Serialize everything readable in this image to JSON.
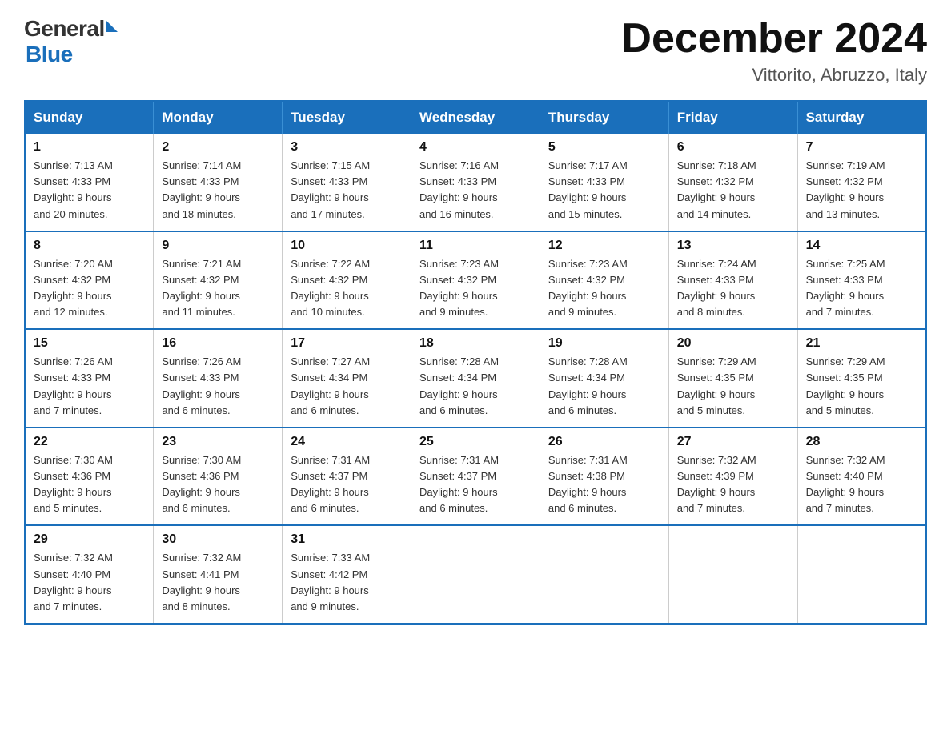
{
  "header": {
    "logo_general": "General",
    "logo_blue": "Blue",
    "title": "December 2024",
    "location": "Vittorito, Abruzzo, Italy"
  },
  "days_of_week": [
    "Sunday",
    "Monday",
    "Tuesday",
    "Wednesday",
    "Thursday",
    "Friday",
    "Saturday"
  ],
  "weeks": [
    [
      {
        "day": "1",
        "sunrise": "7:13 AM",
        "sunset": "4:33 PM",
        "daylight": "9 hours and 20 minutes."
      },
      {
        "day": "2",
        "sunrise": "7:14 AM",
        "sunset": "4:33 PM",
        "daylight": "9 hours and 18 minutes."
      },
      {
        "day": "3",
        "sunrise": "7:15 AM",
        "sunset": "4:33 PM",
        "daylight": "9 hours and 17 minutes."
      },
      {
        "day": "4",
        "sunrise": "7:16 AM",
        "sunset": "4:33 PM",
        "daylight": "9 hours and 16 minutes."
      },
      {
        "day": "5",
        "sunrise": "7:17 AM",
        "sunset": "4:33 PM",
        "daylight": "9 hours and 15 minutes."
      },
      {
        "day": "6",
        "sunrise": "7:18 AM",
        "sunset": "4:32 PM",
        "daylight": "9 hours and 14 minutes."
      },
      {
        "day": "7",
        "sunrise": "7:19 AM",
        "sunset": "4:32 PM",
        "daylight": "9 hours and 13 minutes."
      }
    ],
    [
      {
        "day": "8",
        "sunrise": "7:20 AM",
        "sunset": "4:32 PM",
        "daylight": "9 hours and 12 minutes."
      },
      {
        "day": "9",
        "sunrise": "7:21 AM",
        "sunset": "4:32 PM",
        "daylight": "9 hours and 11 minutes."
      },
      {
        "day": "10",
        "sunrise": "7:22 AM",
        "sunset": "4:32 PM",
        "daylight": "9 hours and 10 minutes."
      },
      {
        "day": "11",
        "sunrise": "7:23 AM",
        "sunset": "4:32 PM",
        "daylight": "9 hours and 9 minutes."
      },
      {
        "day": "12",
        "sunrise": "7:23 AM",
        "sunset": "4:32 PM",
        "daylight": "9 hours and 9 minutes."
      },
      {
        "day": "13",
        "sunrise": "7:24 AM",
        "sunset": "4:33 PM",
        "daylight": "9 hours and 8 minutes."
      },
      {
        "day": "14",
        "sunrise": "7:25 AM",
        "sunset": "4:33 PM",
        "daylight": "9 hours and 7 minutes."
      }
    ],
    [
      {
        "day": "15",
        "sunrise": "7:26 AM",
        "sunset": "4:33 PM",
        "daylight": "9 hours and 7 minutes."
      },
      {
        "day": "16",
        "sunrise": "7:26 AM",
        "sunset": "4:33 PM",
        "daylight": "9 hours and 6 minutes."
      },
      {
        "day": "17",
        "sunrise": "7:27 AM",
        "sunset": "4:34 PM",
        "daylight": "9 hours and 6 minutes."
      },
      {
        "day": "18",
        "sunrise": "7:28 AM",
        "sunset": "4:34 PM",
        "daylight": "9 hours and 6 minutes."
      },
      {
        "day": "19",
        "sunrise": "7:28 AM",
        "sunset": "4:34 PM",
        "daylight": "9 hours and 6 minutes."
      },
      {
        "day": "20",
        "sunrise": "7:29 AM",
        "sunset": "4:35 PM",
        "daylight": "9 hours and 5 minutes."
      },
      {
        "day": "21",
        "sunrise": "7:29 AM",
        "sunset": "4:35 PM",
        "daylight": "9 hours and 5 minutes."
      }
    ],
    [
      {
        "day": "22",
        "sunrise": "7:30 AM",
        "sunset": "4:36 PM",
        "daylight": "9 hours and 5 minutes."
      },
      {
        "day": "23",
        "sunrise": "7:30 AM",
        "sunset": "4:36 PM",
        "daylight": "9 hours and 6 minutes."
      },
      {
        "day": "24",
        "sunrise": "7:31 AM",
        "sunset": "4:37 PM",
        "daylight": "9 hours and 6 minutes."
      },
      {
        "day": "25",
        "sunrise": "7:31 AM",
        "sunset": "4:37 PM",
        "daylight": "9 hours and 6 minutes."
      },
      {
        "day": "26",
        "sunrise": "7:31 AM",
        "sunset": "4:38 PM",
        "daylight": "9 hours and 6 minutes."
      },
      {
        "day": "27",
        "sunrise": "7:32 AM",
        "sunset": "4:39 PM",
        "daylight": "9 hours and 7 minutes."
      },
      {
        "day": "28",
        "sunrise": "7:32 AM",
        "sunset": "4:40 PM",
        "daylight": "9 hours and 7 minutes."
      }
    ],
    [
      {
        "day": "29",
        "sunrise": "7:32 AM",
        "sunset": "4:40 PM",
        "daylight": "9 hours and 7 minutes."
      },
      {
        "day": "30",
        "sunrise": "7:32 AM",
        "sunset": "4:41 PM",
        "daylight": "9 hours and 8 minutes."
      },
      {
        "day": "31",
        "sunrise": "7:33 AM",
        "sunset": "4:42 PM",
        "daylight": "9 hours and 9 minutes."
      },
      null,
      null,
      null,
      null
    ]
  ],
  "labels": {
    "sunrise": "Sunrise: ",
    "sunset": "Sunset: ",
    "daylight": "Daylight: "
  }
}
